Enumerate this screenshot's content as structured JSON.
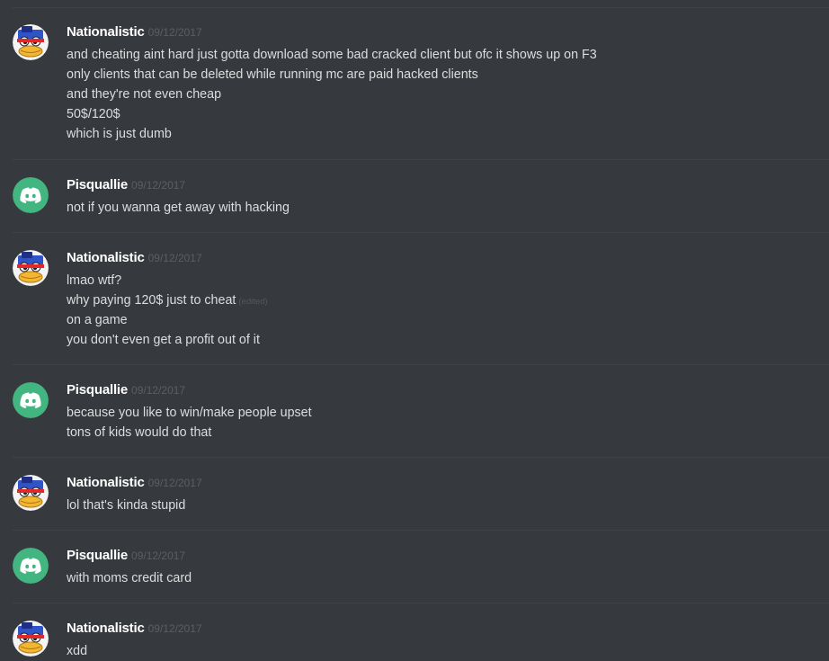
{
  "groups": [
    {
      "author": "Nationalistic",
      "avatar": "duck-avatar",
      "timestamp": "09/12/2017",
      "messages": [
        {
          "text": "and cheating aint hard just gotta download some bad cracked client but ofc it shows up on F3"
        },
        {
          "text": "only clients that can be deleted while running mc are paid hacked clients"
        },
        {
          "text": "and they're not even cheap"
        },
        {
          "text": "50$/120$"
        },
        {
          "text": "which is just dumb"
        }
      ]
    },
    {
      "author": "Pisquallie",
      "avatar": "discord-default-avatar",
      "timestamp": "09/12/2017",
      "messages": [
        {
          "text": "not if you wanna get away with hacking"
        }
      ]
    },
    {
      "author": "Nationalistic",
      "avatar": "duck-avatar",
      "timestamp": "09/12/2017",
      "messages": [
        {
          "text": "lmao wtf?"
        },
        {
          "text": "why paying 120$ just to cheat",
          "edited": "(edited)"
        },
        {
          "text": "on a game"
        },
        {
          "text": "you don't even get a profit out of it"
        }
      ]
    },
    {
      "author": "Pisquallie",
      "avatar": "discord-default-avatar",
      "timestamp": "09/12/2017",
      "messages": [
        {
          "text": "because you like to win/make people upset"
        },
        {
          "text": "tons of kids would do that"
        }
      ]
    },
    {
      "author": "Nationalistic",
      "avatar": "duck-avatar",
      "timestamp": "09/12/2017",
      "messages": [
        {
          "text": "lol that's kinda stupid"
        }
      ]
    },
    {
      "author": "Pisquallie",
      "avatar": "discord-default-avatar",
      "timestamp": "09/12/2017",
      "messages": [
        {
          "text": "with moms credit card"
        }
      ]
    },
    {
      "author": "Nationalistic",
      "avatar": "duck-avatar",
      "timestamp": "09/12/2017",
      "messages": [
        {
          "text": "xdd"
        }
      ]
    }
  ],
  "colors": {
    "background": "#36393e",
    "username": "#ffffff",
    "message_text": "#dcddde",
    "timestamp": "#5b5e63",
    "discord_avatar_bg": "#43b581"
  }
}
